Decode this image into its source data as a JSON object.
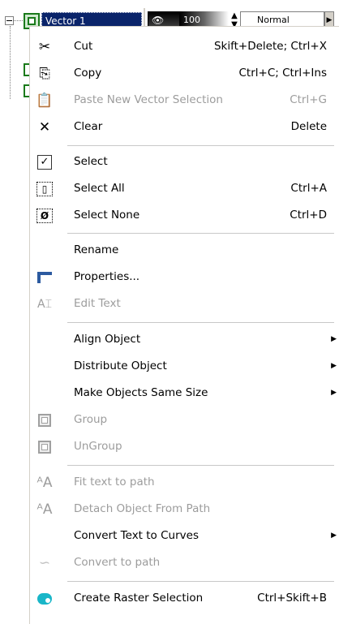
{
  "layer": {
    "name": "Vector 1",
    "opacity": "100",
    "blend_mode": "Normal"
  },
  "menu": {
    "items": [
      {
        "label": "Cut",
        "shortcut": "Skift+Delete; Ctrl+X",
        "icon": "scissors-icon",
        "enabled": true
      },
      {
        "label": "Copy",
        "shortcut": "Ctrl+C; Ctrl+Ins",
        "icon": "copy-icon",
        "enabled": true
      },
      {
        "label": "Paste New Vector Selection",
        "shortcut": "Ctrl+G",
        "icon": "paste-icon",
        "enabled": false
      },
      {
        "label": "Clear",
        "shortcut": "Delete",
        "icon": "x-icon",
        "enabled": true
      },
      {
        "label": "Select",
        "shortcut": "",
        "icon": "check-icon",
        "enabled": true
      },
      {
        "label": "Select All",
        "shortcut": "Ctrl+A",
        "icon": "select-all-icon",
        "enabled": true
      },
      {
        "label": "Select None",
        "shortcut": "Ctrl+D",
        "icon": "select-none-icon",
        "enabled": true
      },
      {
        "label": "Rename",
        "shortcut": "",
        "icon": "",
        "enabled": true
      },
      {
        "label": "Properties...",
        "shortcut": "",
        "icon": "properties-icon",
        "enabled": true
      },
      {
        "label": "Edit Text",
        "shortcut": "",
        "icon": "edit-text-icon",
        "enabled": false
      },
      {
        "label": "Align Object",
        "shortcut": "",
        "icon": "",
        "enabled": true,
        "submenu": true
      },
      {
        "label": "Distribute Object",
        "shortcut": "",
        "icon": "",
        "enabled": true,
        "submenu": true
      },
      {
        "label": "Make Objects Same Size",
        "shortcut": "",
        "icon": "",
        "enabled": true,
        "submenu": true
      },
      {
        "label": "Group",
        "shortcut": "",
        "icon": "group-icon",
        "enabled": false
      },
      {
        "label": "UnGroup",
        "shortcut": "",
        "icon": "ungroup-icon",
        "enabled": false
      },
      {
        "label": "Fit text to path",
        "shortcut": "",
        "icon": "fit-text-icon",
        "enabled": false
      },
      {
        "label": "Detach Object From Path",
        "shortcut": "",
        "icon": "detach-icon",
        "enabled": false
      },
      {
        "label": "Convert Text to Curves",
        "shortcut": "",
        "icon": "",
        "enabled": true,
        "submenu": true
      },
      {
        "label": "Convert to path",
        "shortcut": "",
        "icon": "convert-path-icon",
        "enabled": false
      },
      {
        "label": "Create Raster Selection",
        "shortcut": "Ctrl+Skift+B",
        "icon": "raster-selection-icon",
        "enabled": true
      }
    ]
  }
}
